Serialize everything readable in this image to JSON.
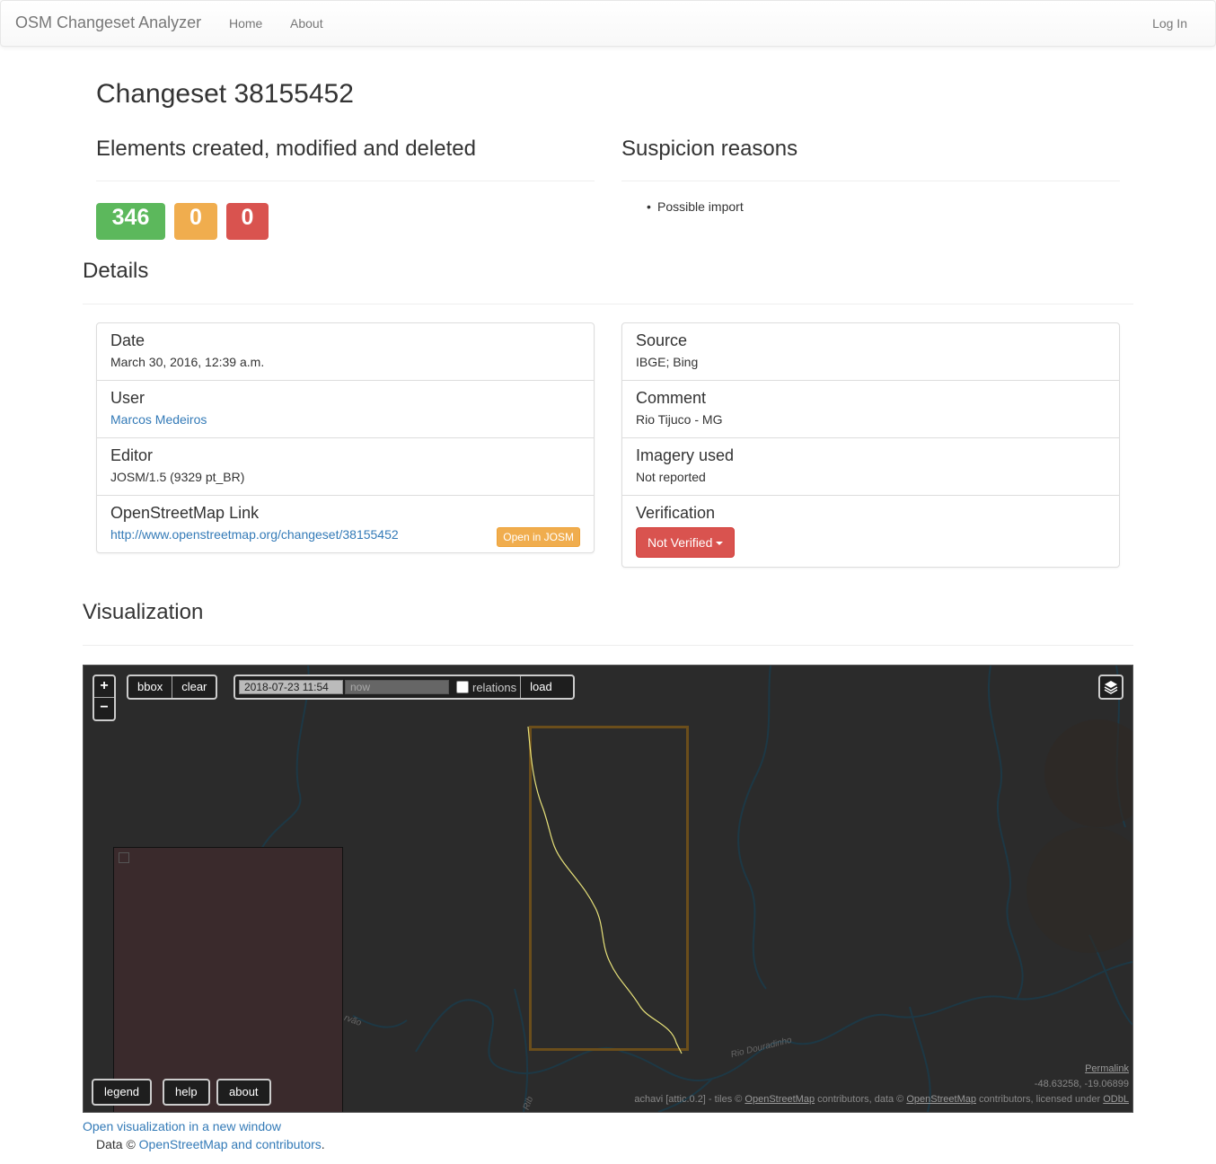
{
  "navbar": {
    "brand": "OSM Changeset Analyzer",
    "home": "Home",
    "about": "About",
    "login": "Log In"
  },
  "page": {
    "title": "Changeset 38155452",
    "elements_heading": "Elements created, modified and deleted",
    "suspicion_heading": "Suspicion reasons",
    "details_heading": "Details",
    "visualization_heading": "Visualization"
  },
  "counts": {
    "created": "346",
    "modified": "0",
    "deleted": "0",
    "colors": {
      "created": "#5cb85c",
      "modified": "#f0ad4e",
      "deleted": "#d9534f"
    }
  },
  "suspicion_reasons": [
    "Possible import"
  ],
  "details_left": {
    "date_label": "Date",
    "date_value": "March 30, 2016, 12:39 a.m.",
    "user_label": "User",
    "user_value": "Marcos Medeiros",
    "editor_label": "Editor",
    "editor_value": "JOSM/1.5 (9329 pt_BR)",
    "osm_link_label": "OpenStreetMap Link",
    "osm_link_value": "http://www.openstreetmap.org/changeset/38155452",
    "open_josm": "Open in JOSM"
  },
  "details_right": {
    "source_label": "Source",
    "source_value": "IBGE; Bing",
    "comment_label": "Comment",
    "comment_value": "Rio Tijuco - MG",
    "imagery_label": "Imagery used",
    "imagery_value": "Not reported",
    "verification_label": "Verification",
    "verification_button": "Not Verified"
  },
  "map": {
    "zoom_in": "+",
    "zoom_out": "−",
    "bbox": "bbox",
    "clear": "clear",
    "date_from": "2018-07-23 11:54",
    "date_to_placeholder": "now",
    "relations": "relations",
    "load": "load",
    "legend": "legend",
    "help": "help",
    "about": "about",
    "permalink": "Permalink",
    "coords": "-48.63258, -19.06899",
    "attrib_prefix": "achavi [attic.0.2]   -   tiles © ",
    "attrib_osm1": "OpenStreetMap",
    "attrib_mid": " contributors, data © ",
    "attrib_osm2": "OpenStreetMap",
    "attrib_suffix": " contributors, licensed under ",
    "attrib_odbl": "ODbL",
    "label_river1": "Rio Douradinho",
    "label_river2": "rvão",
    "label_river3": "Rib",
    "highlight_color": "#e8e27a",
    "bbox_color": "#6b4e1b"
  },
  "footer": {
    "open_visualization": "Open visualization in a new window",
    "data_prefix": "Data © ",
    "data_link": "OpenStreetMap and contributors",
    "data_suffix": "."
  }
}
